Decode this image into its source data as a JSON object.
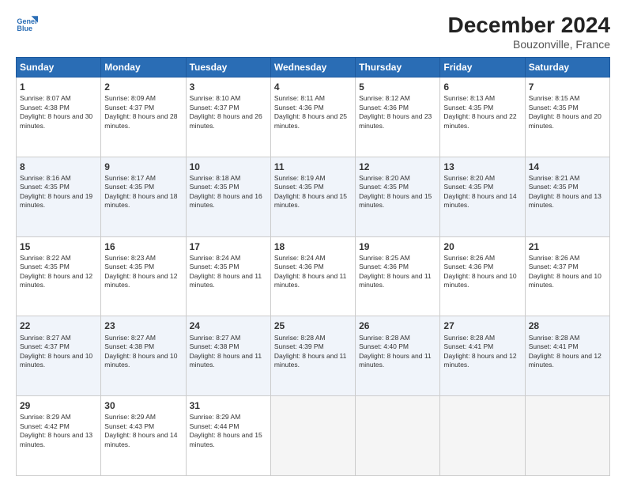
{
  "logo": {
    "line1": "General",
    "line2": "Blue"
  },
  "title": "December 2024",
  "subtitle": "Bouzonville, France",
  "days_of_week": [
    "Sunday",
    "Monday",
    "Tuesday",
    "Wednesday",
    "Thursday",
    "Friday",
    "Saturday"
  ],
  "weeks": [
    [
      {
        "day": 1,
        "sunrise": "8:07 AM",
        "sunset": "4:38 PM",
        "daylight": "8 hours and 30 minutes."
      },
      {
        "day": 2,
        "sunrise": "8:09 AM",
        "sunset": "4:37 PM",
        "daylight": "8 hours and 28 minutes."
      },
      {
        "day": 3,
        "sunrise": "8:10 AM",
        "sunset": "4:37 PM",
        "daylight": "8 hours and 26 minutes."
      },
      {
        "day": 4,
        "sunrise": "8:11 AM",
        "sunset": "4:36 PM",
        "daylight": "8 hours and 25 minutes."
      },
      {
        "day": 5,
        "sunrise": "8:12 AM",
        "sunset": "4:36 PM",
        "daylight": "8 hours and 23 minutes."
      },
      {
        "day": 6,
        "sunrise": "8:13 AM",
        "sunset": "4:35 PM",
        "daylight": "8 hours and 22 minutes."
      },
      {
        "day": 7,
        "sunrise": "8:15 AM",
        "sunset": "4:35 PM",
        "daylight": "8 hours and 20 minutes."
      }
    ],
    [
      {
        "day": 8,
        "sunrise": "8:16 AM",
        "sunset": "4:35 PM",
        "daylight": "8 hours and 19 minutes."
      },
      {
        "day": 9,
        "sunrise": "8:17 AM",
        "sunset": "4:35 PM",
        "daylight": "8 hours and 18 minutes."
      },
      {
        "day": 10,
        "sunrise": "8:18 AM",
        "sunset": "4:35 PM",
        "daylight": "8 hours and 16 minutes."
      },
      {
        "day": 11,
        "sunrise": "8:19 AM",
        "sunset": "4:35 PM",
        "daylight": "8 hours and 15 minutes."
      },
      {
        "day": 12,
        "sunrise": "8:20 AM",
        "sunset": "4:35 PM",
        "daylight": "8 hours and 15 minutes."
      },
      {
        "day": 13,
        "sunrise": "8:20 AM",
        "sunset": "4:35 PM",
        "daylight": "8 hours and 14 minutes."
      },
      {
        "day": 14,
        "sunrise": "8:21 AM",
        "sunset": "4:35 PM",
        "daylight": "8 hours and 13 minutes."
      }
    ],
    [
      {
        "day": 15,
        "sunrise": "8:22 AM",
        "sunset": "4:35 PM",
        "daylight": "8 hours and 12 minutes."
      },
      {
        "day": 16,
        "sunrise": "8:23 AM",
        "sunset": "4:35 PM",
        "daylight": "8 hours and 12 minutes."
      },
      {
        "day": 17,
        "sunrise": "8:24 AM",
        "sunset": "4:35 PM",
        "daylight": "8 hours and 11 minutes."
      },
      {
        "day": 18,
        "sunrise": "8:24 AM",
        "sunset": "4:36 PM",
        "daylight": "8 hours and 11 minutes."
      },
      {
        "day": 19,
        "sunrise": "8:25 AM",
        "sunset": "4:36 PM",
        "daylight": "8 hours and 11 minutes."
      },
      {
        "day": 20,
        "sunrise": "8:26 AM",
        "sunset": "4:36 PM",
        "daylight": "8 hours and 10 minutes."
      },
      {
        "day": 21,
        "sunrise": "8:26 AM",
        "sunset": "4:37 PM",
        "daylight": "8 hours and 10 minutes."
      }
    ],
    [
      {
        "day": 22,
        "sunrise": "8:27 AM",
        "sunset": "4:37 PM",
        "daylight": "8 hours and 10 minutes."
      },
      {
        "day": 23,
        "sunrise": "8:27 AM",
        "sunset": "4:38 PM",
        "daylight": "8 hours and 10 minutes."
      },
      {
        "day": 24,
        "sunrise": "8:27 AM",
        "sunset": "4:38 PM",
        "daylight": "8 hours and 11 minutes."
      },
      {
        "day": 25,
        "sunrise": "8:28 AM",
        "sunset": "4:39 PM",
        "daylight": "8 hours and 11 minutes."
      },
      {
        "day": 26,
        "sunrise": "8:28 AM",
        "sunset": "4:40 PM",
        "daylight": "8 hours and 11 minutes."
      },
      {
        "day": 27,
        "sunrise": "8:28 AM",
        "sunset": "4:41 PM",
        "daylight": "8 hours and 12 minutes."
      },
      {
        "day": 28,
        "sunrise": "8:28 AM",
        "sunset": "4:41 PM",
        "daylight": "8 hours and 12 minutes."
      }
    ],
    [
      {
        "day": 29,
        "sunrise": "8:29 AM",
        "sunset": "4:42 PM",
        "daylight": "8 hours and 13 minutes."
      },
      {
        "day": 30,
        "sunrise": "8:29 AM",
        "sunset": "4:43 PM",
        "daylight": "8 hours and 14 minutes."
      },
      {
        "day": 31,
        "sunrise": "8:29 AM",
        "sunset": "4:44 PM",
        "daylight": "8 hours and 15 minutes."
      },
      null,
      null,
      null,
      null
    ]
  ],
  "labels": {
    "sunrise": "Sunrise:",
    "sunset": "Sunset:",
    "daylight": "Daylight:"
  }
}
